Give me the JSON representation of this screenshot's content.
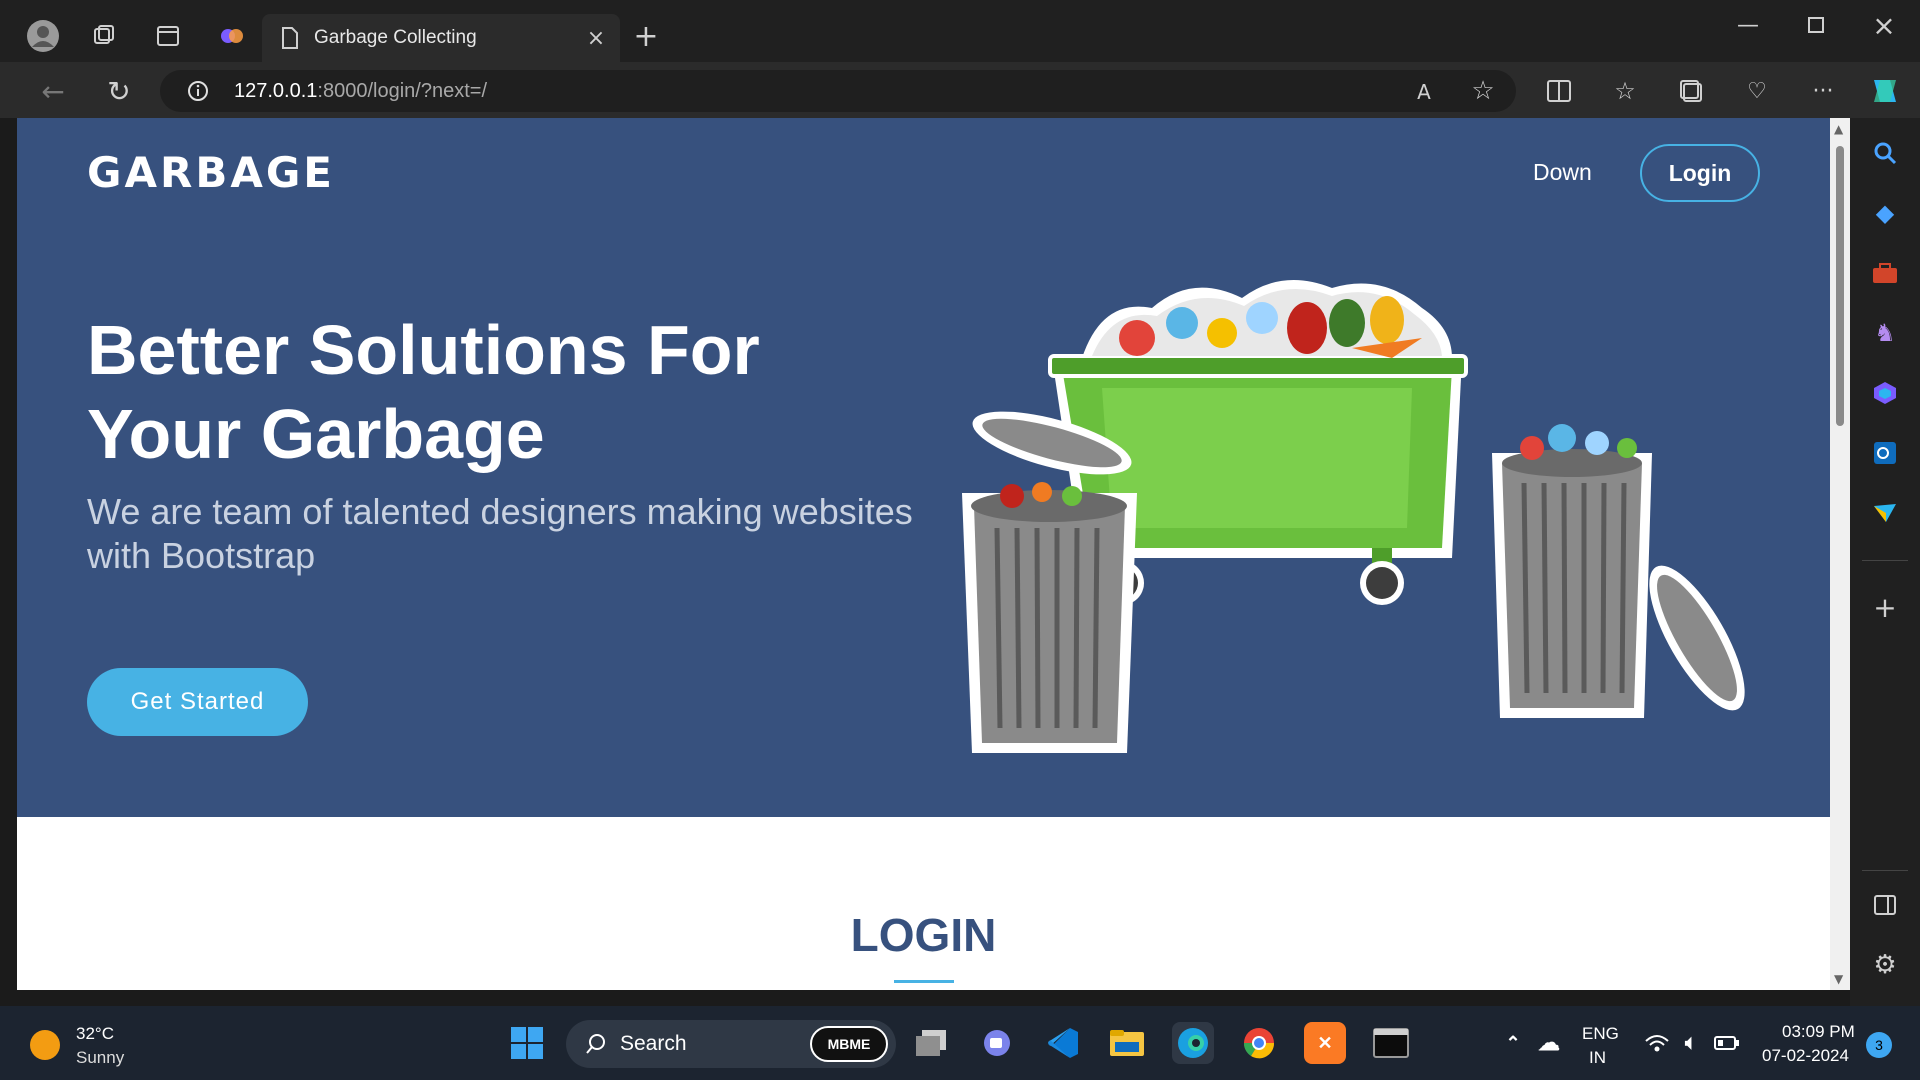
{
  "browser": {
    "tab_title": "Garbage Collecting",
    "url_host": "127.0.0.1",
    "url_rest": ":8000/login/?next=/"
  },
  "page": {
    "brand": "GARBAGE",
    "nav": {
      "down": "Down",
      "login": "Login"
    },
    "hero_title": "Better Solutions For Your Garbage",
    "hero_subtitle": "We are team of talented designers making websites with Bootstrap",
    "cta": "Get Started",
    "section_title": "LOGIN"
  },
  "taskbar": {
    "weather_temp": "32°C",
    "weather_desc": "Sunny",
    "search_placeholder": "Search",
    "mbme_label": "MBME",
    "lang_top": "ENG",
    "lang_bottom": "IN",
    "time": "03:09 PM",
    "date": "07-02-2024",
    "notification_count": "3"
  },
  "colors": {
    "hero_bg": "#37517e",
    "accent": "#47b2e4",
    "section_title": "#37517e"
  }
}
